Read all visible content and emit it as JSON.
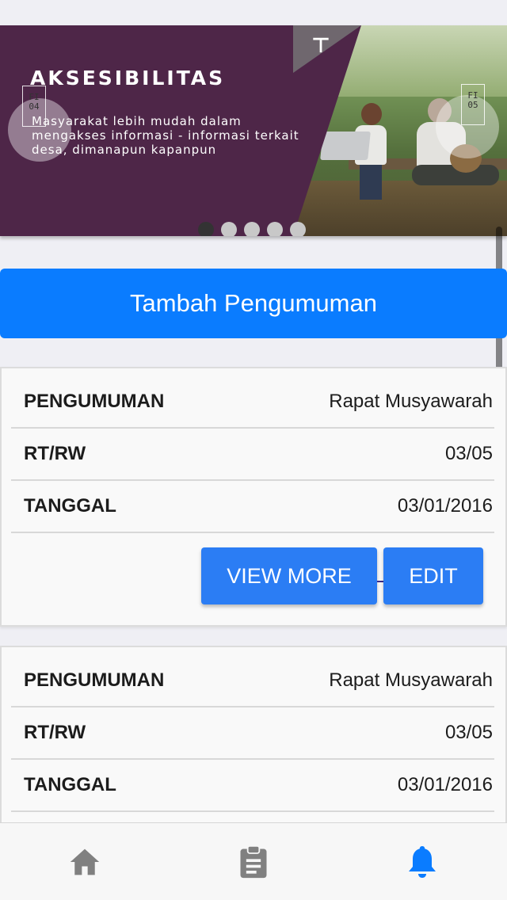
{
  "banner": {
    "title": "AKSESIBILITAS",
    "subtitle": "Masyarakat lebih mudah dalam mengakses informasi - informasi terkait desa, dimanapun kapanpun",
    "prev_label": "FI 04",
    "next_label": "FI 05",
    "slides": 5,
    "active_slide": 1
  },
  "add_button": {
    "label": "Tambah Pengumuman"
  },
  "announcements": [
    {
      "rows": [
        {
          "key": "PENGUMUMAN",
          "value": "Rapat Musyawarah"
        },
        {
          "key": "RT/RW",
          "value": "03/05"
        },
        {
          "key": "TANGGAL",
          "value": "03/01/2016"
        }
      ],
      "view_more_label": "VIEW MORE",
      "edit_label": "EDIT"
    },
    {
      "rows": [
        {
          "key": "PENGUMUMAN",
          "value": "Rapat Musyawarah"
        },
        {
          "key": "RT/RW",
          "value": "03/05"
        },
        {
          "key": "TANGGAL",
          "value": "03/01/2016"
        }
      ]
    }
  ],
  "tabbar": {
    "items": [
      {
        "icon": "home-icon",
        "active": false
      },
      {
        "icon": "clipboard-icon",
        "active": false
      },
      {
        "icon": "bell-icon",
        "active": true
      }
    ],
    "active_color": "#0a7cff",
    "inactive_color": "#808080"
  },
  "colors": {
    "accent": "#0a7cff",
    "banner_bg": "#4e2648"
  }
}
